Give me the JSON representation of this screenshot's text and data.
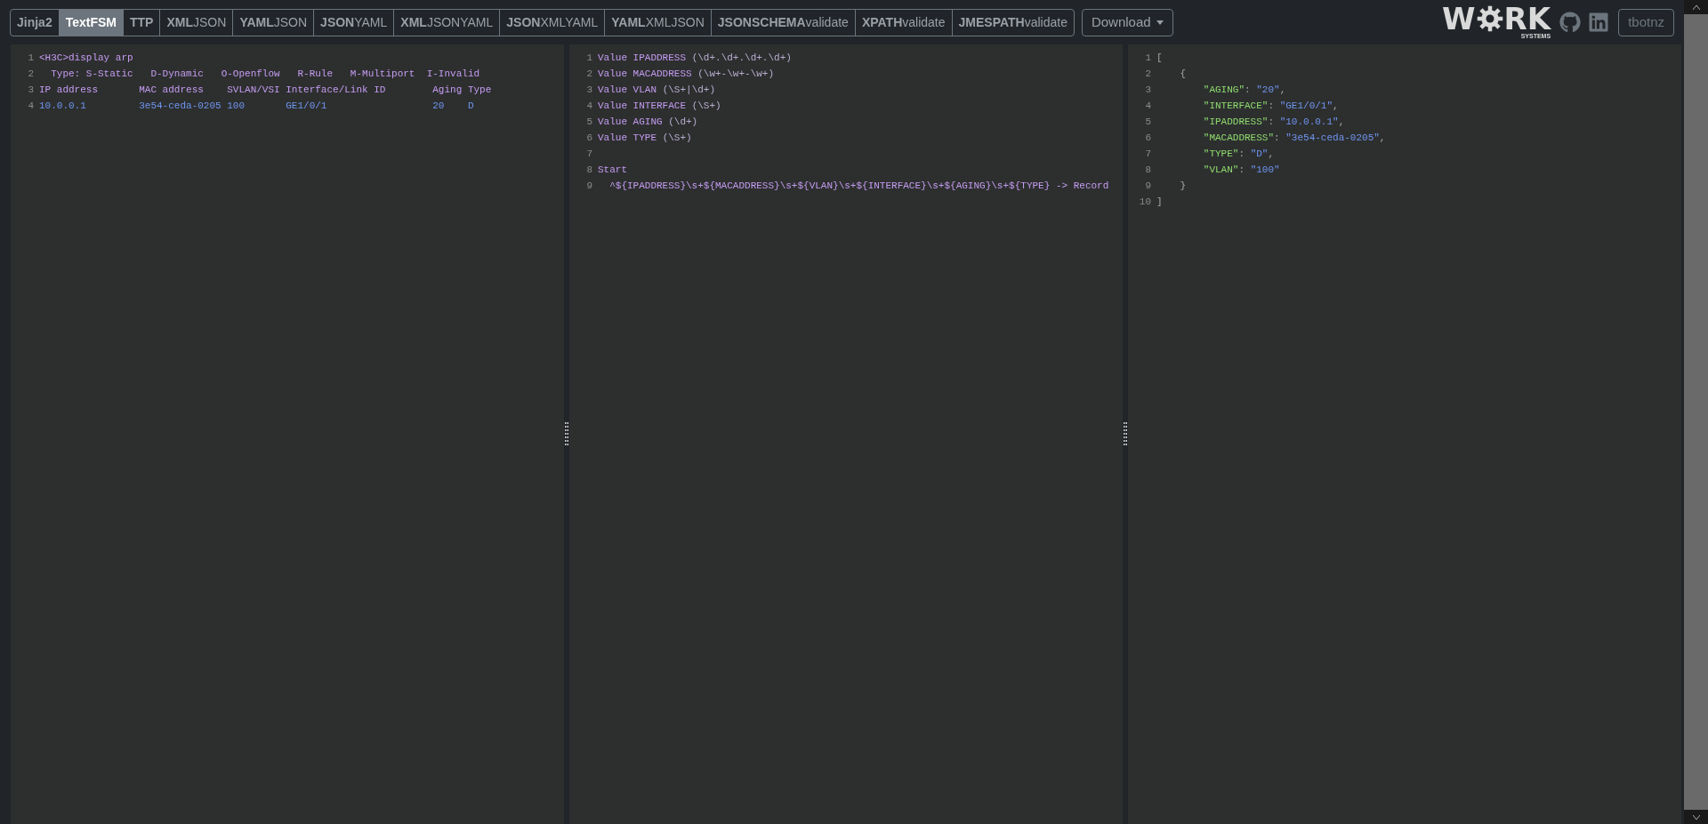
{
  "toolbar": {
    "tabs": [
      {
        "label": "Jinja2",
        "kind": "bold",
        "selected": false
      },
      {
        "label": "TextFSM",
        "kind": "bold",
        "selected": true
      },
      {
        "label": "TTP",
        "kind": "bold",
        "selected": false
      },
      {
        "label": "**XML**JSON",
        "kind": "split",
        "selected": false
      },
      {
        "label": "**YAML**JSON",
        "kind": "split",
        "selected": false
      },
      {
        "label": "**JSON**YAML",
        "kind": "split",
        "selected": false
      },
      {
        "label": "**XML**JSONYAML",
        "kind": "split",
        "selected": false
      },
      {
        "label": "**JSON**XMLYAML",
        "kind": "split",
        "selected": false
      },
      {
        "label": "**YAML**XMLJSON",
        "kind": "split",
        "selected": false
      },
      {
        "label": "**JSONSCHEMA**validate",
        "kind": "split",
        "selected": false
      },
      {
        "label": "**XPATH**validate",
        "kind": "split",
        "selected": false
      },
      {
        "label": "**JMESPATH**validate",
        "kind": "split",
        "selected": false
      }
    ],
    "download": "Download",
    "logo": {
      "before": "W",
      "after": "RK",
      "subtitle": "SYSTEMS"
    },
    "user_button": "tbotnz"
  },
  "panels": [
    {
      "lines": [
        {
          "number": "1",
          "segments": [
            {
              "text": "<H3C>display arp",
              "kind": "keyword"
            }
          ]
        },
        {
          "number": "2",
          "segments": [
            {
              "text": "  Type: S-Static   D-Dynamic   O-Openflow   R-Rule   M-Multiport  I-Invalid",
              "kind": "keyword"
            }
          ]
        },
        {
          "number": "3",
          "segments": [
            {
              "text": "IP address       MAC address    SVLAN/VSI Interface/Link ID        Aging Type",
              "kind": "keyword"
            }
          ]
        },
        {
          "number": "4",
          "segments": [
            {
              "text": "10.0.0.1         3e54-ceda-0205 100       GE1/0/1                  20    D",
              "kind": "value"
            }
          ]
        }
      ]
    },
    {
      "lines": [
        {
          "number": "1",
          "segments": [
            {
              "text": "Value IPADDRESS ",
              "kind": "keyword"
            },
            {
              "text": "(\\d+.\\d+.\\d+.\\d+)",
              "kind": "plain"
            }
          ]
        },
        {
          "number": "2",
          "segments": [
            {
              "text": "Value MACADDRESS ",
              "kind": "keyword"
            },
            {
              "text": "(\\w+-\\w+-\\w+)",
              "kind": "plain"
            }
          ]
        },
        {
          "number": "3",
          "segments": [
            {
              "text": "Value VLAN ",
              "kind": "keyword"
            },
            {
              "text": "(\\S+|\\d+)",
              "kind": "plain"
            }
          ]
        },
        {
          "number": "4",
          "segments": [
            {
              "text": "Value INTERFACE ",
              "kind": "keyword"
            },
            {
              "text": "(\\S+)",
              "kind": "plain"
            }
          ]
        },
        {
          "number": "5",
          "segments": [
            {
              "text": "Value AGING ",
              "kind": "keyword"
            },
            {
              "text": "(\\d+)",
              "kind": "plain"
            }
          ]
        },
        {
          "number": "6",
          "segments": [
            {
              "text": "Value TYPE ",
              "kind": "keyword"
            },
            {
              "text": "(\\S+)",
              "kind": "plain"
            }
          ]
        },
        {
          "number": "7"
        },
        {
          "number": "8",
          "segments": [
            {
              "text": "Start",
              "kind": "keyword"
            }
          ]
        },
        {
          "number": "9",
          "segments": [
            {
              "text": "  ^${IPADDRESS}\\s+${MACADDRESS}\\s+${VLAN}\\s+${INTERFACE}\\s+${AGING}\\s+${TYPE} -> Record",
              "kind": "keyword"
            }
          ]
        }
      ]
    },
    {
      "lines": [
        {
          "number": "1",
          "segments": [
            {
              "text": "[",
              "kind": "punct"
            }
          ]
        },
        {
          "number": "2",
          "segments": [
            {
              "text": "    {",
              "kind": "punct"
            }
          ]
        },
        {
          "number": "3",
          "segments": [
            {
              "text": "        \"AGING\"",
              "kind": "key"
            },
            {
              "text": ": ",
              "kind": "punct"
            },
            {
              "text": "\"20\"",
              "kind": "value"
            },
            {
              "text": ",",
              "kind": "punct"
            }
          ]
        },
        {
          "number": "4",
          "segments": [
            {
              "text": "        \"INTERFACE\"",
              "kind": "key"
            },
            {
              "text": ": ",
              "kind": "punct"
            },
            {
              "text": "\"GE1/0/1\"",
              "kind": "value"
            },
            {
              "text": ",",
              "kind": "punct"
            }
          ]
        },
        {
          "number": "5",
          "segments": [
            {
              "text": "        \"IPADDRESS\"",
              "kind": "key"
            },
            {
              "text": ": ",
              "kind": "punct"
            },
            {
              "text": "\"10.0.0.1\"",
              "kind": "value"
            },
            {
              "text": ",",
              "kind": "punct"
            }
          ]
        },
        {
          "number": "6",
          "segments": [
            {
              "text": "        \"MACADDRESS\"",
              "kind": "key"
            },
            {
              "text": ": ",
              "kind": "punct"
            },
            {
              "text": "\"3e54-ceda-0205\"",
              "kind": "value"
            },
            {
              "text": ",",
              "kind": "punct"
            }
          ]
        },
        {
          "number": "7",
          "segments": [
            {
              "text": "        \"TYPE\"",
              "kind": "key"
            },
            {
              "text": ": ",
              "kind": "punct"
            },
            {
              "text": "\"D\"",
              "kind": "value"
            },
            {
              "text": ",",
              "kind": "punct"
            }
          ]
        },
        {
          "number": "8",
          "segments": [
            {
              "text": "        \"VLAN\"",
              "kind": "key"
            },
            {
              "text": ": ",
              "kind": "punct"
            },
            {
              "text": "\"100\"",
              "kind": "value"
            }
          ]
        },
        {
          "number": "9",
          "segments": [
            {
              "text": "    }",
              "kind": "punct"
            }
          ]
        },
        {
          "number": "10",
          "segments": [
            {
              "text": "]",
              "kind": "punct"
            }
          ]
        }
      ]
    }
  ]
}
